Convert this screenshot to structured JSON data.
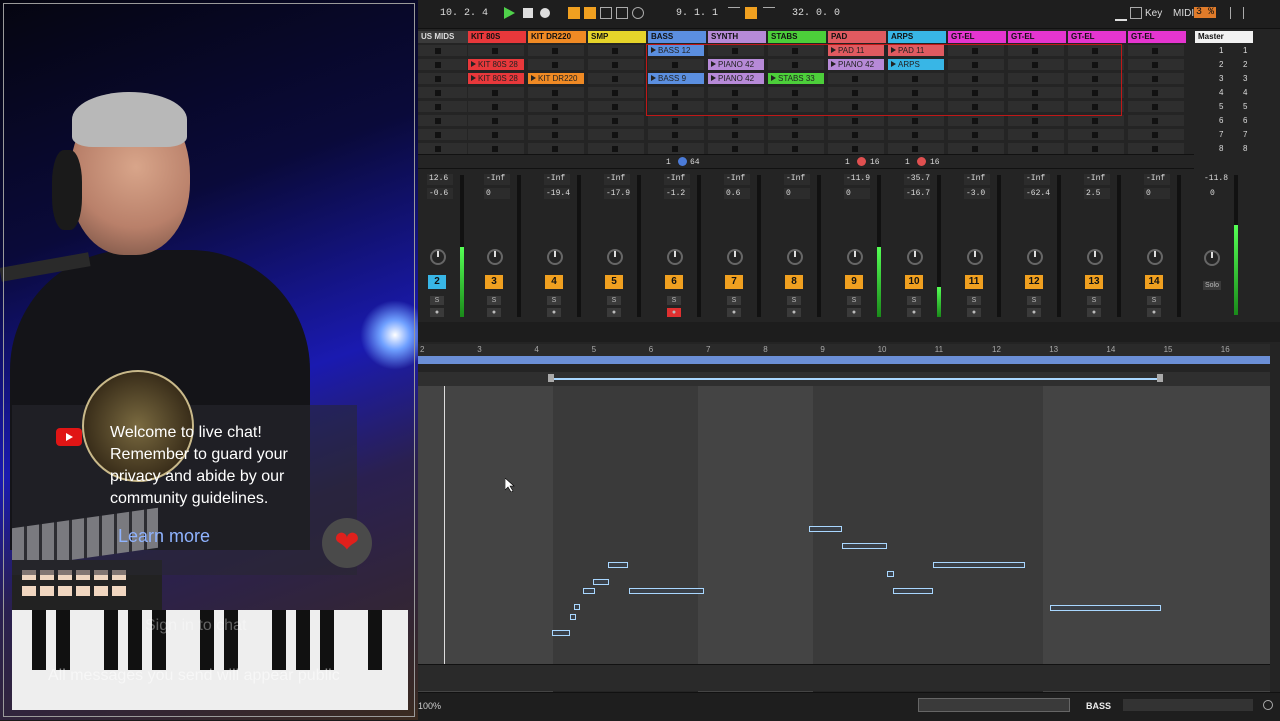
{
  "chat": {
    "welcome": "Welcome to live chat! Remember to guard your privacy and abide by our community guidelines.",
    "learn_more": "Learn more",
    "sign_in": "Sign in to chat",
    "all_messages": "All messages you send will appear public"
  },
  "transport": {
    "signature": "10. 2. 4",
    "position": "9. 1. 1",
    "loop_length": "32. 0. 0",
    "key_label": "Key",
    "midi_label": "MIDI",
    "cpu": "3 %"
  },
  "tracks": [
    {
      "name": "US MIDS",
      "color": "#3a3a3a",
      "num": "2",
      "top": "12.6",
      "val": "-0.6"
    },
    {
      "name": "KIT 80S",
      "color": "#e8383b",
      "num": "3",
      "top": "-Inf",
      "val": "0"
    },
    {
      "name": "KIT DR220",
      "color": "#f08a24",
      "num": "4",
      "top": "-Inf",
      "val": "-19.4"
    },
    {
      "name": "SMP",
      "color": "#e6d42a",
      "num": "5",
      "top": "-Inf",
      "val": "-17.9"
    },
    {
      "name": "BASS",
      "color": "#5b8fe0",
      "num": "6",
      "top": "-Inf",
      "val": "-1.2"
    },
    {
      "name": "SYNTH",
      "color": "#b78ad8",
      "num": "7",
      "top": "-Inf",
      "val": "0.6"
    },
    {
      "name": "STABS",
      "color": "#4ccf3a",
      "num": "8",
      "top": "-Inf",
      "val": "0"
    },
    {
      "name": "PAD",
      "color": "#e05a60",
      "num": "9",
      "top": "-11.9",
      "val": "0"
    },
    {
      "name": "ARPS",
      "color": "#38b6e6",
      "num": "10",
      "top": "-35.7",
      "val": "-16.7"
    },
    {
      "name": "GT-EL",
      "color": "#e535d0",
      "num": "11",
      "top": "-Inf",
      "val": "-3.0"
    },
    {
      "name": "GT-EL",
      "color": "#e535d0",
      "num": "12",
      "top": "-Inf",
      "val": "-62.4"
    },
    {
      "name": "GT-EL",
      "color": "#e535d0",
      "num": "13",
      "top": "-Inf",
      "val": "2.5"
    },
    {
      "name": "GT-EL",
      "color": "#e535d0",
      "num": "14",
      "top": "-Inf",
      "val": "0"
    }
  ],
  "master": {
    "name": "Master",
    "top": "-11.8",
    "val": "0",
    "solo": "Solo",
    "scenes": [
      "1",
      "2",
      "3",
      "4",
      "5",
      "6",
      "7",
      "8"
    ]
  },
  "clips": {
    "kit1": "KIT 80S 28",
    "kit2": "KIT 80S 28",
    "dr": "KIT DR220",
    "bass1": "BASS 12",
    "bass2": "BASS 9",
    "synth1": "PIANO 42",
    "synth2": "PIANO 42",
    "stabs": "STABS 33",
    "pad1": "PAD 11",
    "pad2": "PIANO 42",
    "arps1": "PAD 11",
    "arps2": "ARPS"
  },
  "routing": {
    "bass": "1",
    "bass_num": "64",
    "pad": "1",
    "pad_num": "16",
    "arps": "1",
    "arps_num": "16"
  },
  "ruler": [
    "2",
    "3",
    "4",
    "5",
    "6",
    "7",
    "8",
    "9",
    "10",
    "11",
    "12",
    "13",
    "14",
    "15",
    "16"
  ],
  "bottom": {
    "zoom": "100%",
    "track_label": "BASS"
  }
}
